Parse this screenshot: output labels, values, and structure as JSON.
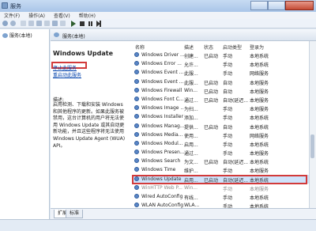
{
  "window": {
    "title": "服务"
  },
  "menu": [
    "文件(F)",
    "操作(A)",
    "查看(V)",
    "帮助(H)"
  ],
  "tree": {
    "root": "服务(本地)"
  },
  "panel": {
    "title": "服务(本地)"
  },
  "detail": {
    "service_name": "Windows Update",
    "stop_link": "停止此服务",
    "restart_link": "重启动此服务",
    "description_label": "描述:",
    "description": "启用检测、下载和安装 Windows 和其他程序的更新。如果此服务被禁用，这台计算机的用户将无法使用 Windows Update 或其自动更新功能，并且这些程序将无法使用 Windows Update Agent (WUA) API。"
  },
  "columns": {
    "name": "名称",
    "desc": "描述",
    "status": "状态",
    "start": "启动类型",
    "logon": "登录为"
  },
  "services": [
    {
      "name": "Windows Driver ...",
      "desc": "创建...",
      "status": "已启动",
      "start": "手动",
      "logon": "本地系统"
    },
    {
      "name": "Windows Error ...",
      "desc": "允许...",
      "status": "",
      "start": "手动",
      "logon": "本地系统"
    },
    {
      "name": "Windows Event ...",
      "desc": "此服...",
      "status": "",
      "start": "手动",
      "logon": "网络服务"
    },
    {
      "name": "Windows Event ...",
      "desc": "此服...",
      "status": "已启动",
      "start": "自动",
      "logon": "本地服务"
    },
    {
      "name": "Windows Firewall",
      "desc": "Win...",
      "status": "已启动",
      "start": "自动",
      "logon": "本地服务"
    },
    {
      "name": "Windows Font C...",
      "desc": "通过...",
      "status": "已启动",
      "start": "自动(延迟...",
      "logon": "本地服务"
    },
    {
      "name": "Windows Image ...",
      "desc": "为扫...",
      "status": "",
      "start": "手动",
      "logon": "本地服务"
    },
    {
      "name": "Windows Installer",
      "desc": "添加...",
      "status": "",
      "start": "手动",
      "logon": "本地系统"
    },
    {
      "name": "Windows Manag...",
      "desc": "提供...",
      "status": "已启动",
      "start": "自动",
      "logon": "本地系统"
    },
    {
      "name": "Windows Media...",
      "desc": "使用...",
      "status": "",
      "start": "手动",
      "logon": "网络服务"
    },
    {
      "name": "Windows Modul...",
      "desc": "启用...",
      "status": "",
      "start": "手动",
      "logon": "本地系统"
    },
    {
      "name": "Windows Presen...",
      "desc": "通过...",
      "status": "",
      "start": "手动",
      "logon": "本地服务"
    },
    {
      "name": "Windows Search",
      "desc": "为文...",
      "status": "已启动",
      "start": "自动(延迟...",
      "logon": "本地系统"
    },
    {
      "name": "Windows Time",
      "desc": "维护...",
      "status": "",
      "start": "手动",
      "logon": "本地服务"
    },
    {
      "name": "Windows Update",
      "desc": "启用...",
      "status": "已启动",
      "start": "自动(延迟...",
      "logon": "本地系统"
    },
    {
      "name": "WinHTTP Web P...",
      "desc": "Win...",
      "status": "",
      "start": "手动",
      "logon": "本地服务"
    },
    {
      "name": "Wired AutoConfig",
      "desc": "有线...",
      "status": "",
      "start": "手动",
      "logon": "本地系统"
    },
    {
      "name": "WLAN AutoConfig",
      "desc": "WLA...",
      "status": "",
      "start": "手动",
      "logon": "本地系统"
    }
  ],
  "tabs": [
    "扩展",
    "标准"
  ],
  "colors": {
    "highlight": "#d23a3a",
    "selection": "#cfe3fb",
    "link": "#0645ad"
  }
}
